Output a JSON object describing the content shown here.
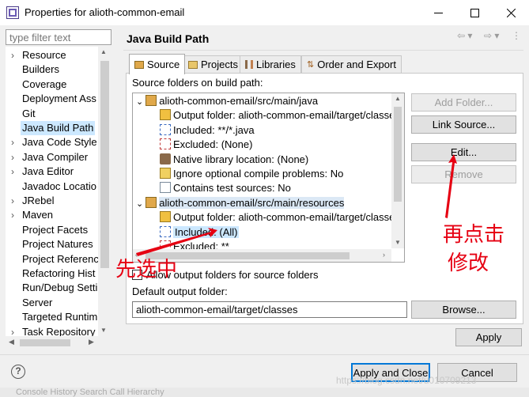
{
  "window": {
    "title": "Properties for alioth-common-email"
  },
  "filter": {
    "placeholder": "type filter text"
  },
  "nav": {
    "items": [
      {
        "label": "Resource",
        "expandable": true
      },
      {
        "label": "Builders",
        "expandable": false
      },
      {
        "label": "Coverage",
        "expandable": false
      },
      {
        "label": "Deployment Ass",
        "expandable": false
      },
      {
        "label": "Git",
        "expandable": false
      },
      {
        "label": "Java Build Path",
        "expandable": false,
        "selected": true
      },
      {
        "label": "Java Code Style",
        "expandable": true
      },
      {
        "label": "Java Compiler",
        "expandable": true
      },
      {
        "label": "Java Editor",
        "expandable": true
      },
      {
        "label": "Javadoc Locatio",
        "expandable": false
      },
      {
        "label": "JRebel",
        "expandable": true
      },
      {
        "label": "Maven",
        "expandable": true
      },
      {
        "label": "Project Facets",
        "expandable": false
      },
      {
        "label": "Project Natures",
        "expandable": false
      },
      {
        "label": "Project Referenc",
        "expandable": false
      },
      {
        "label": "Refactoring Hist",
        "expandable": false
      },
      {
        "label": "Run/Debug Setti",
        "expandable": false
      },
      {
        "label": "Server",
        "expandable": false
      },
      {
        "label": "Targeted Runtim",
        "expandable": false
      },
      {
        "label": "Task Repository",
        "expandable": true
      }
    ]
  },
  "page": {
    "title": "Java Build Path",
    "tabs": [
      {
        "label": "Source",
        "active": true
      },
      {
        "label": "Projects"
      },
      {
        "label": "Libraries"
      },
      {
        "label": "Order and Export"
      }
    ],
    "source_label": "Source folders on build path:",
    "source_tree": [
      {
        "text": "alioth-common-email/src/main/java",
        "icon": "source-folder-icon",
        "expanded": true
      },
      {
        "text": "Output folder: alioth-common-email/target/classes",
        "icon": "output-folder-icon"
      },
      {
        "text": "Included: **/*.java",
        "icon": "inclusion-filter-icon"
      },
      {
        "text": "Excluded: (None)",
        "icon": "exclusion-filter-icon"
      },
      {
        "text": "Native library location: (None)",
        "icon": "native-library-icon"
      },
      {
        "text": "Ignore optional compile problems: No",
        "icon": "ignore-problems-icon"
      },
      {
        "text": "Contains test sources: No",
        "icon": "test-sources-icon"
      },
      {
        "text": "alioth-common-email/src/main/resources",
        "icon": "source-folder-icon",
        "expanded": true,
        "highlight": true
      },
      {
        "text": "Output folder: alioth-common-email/target/classes",
        "icon": "output-folder-icon"
      },
      {
        "text": "Included: (All)",
        "icon": "inclusion-filter-icon",
        "selected": true
      },
      {
        "text": "Excluded: **",
        "icon": "exclusion-filter-icon"
      }
    ],
    "buttons": {
      "add_folder": "Add Folder...",
      "link_source": "Link Source...",
      "edit": "Edit...",
      "remove": "Remove"
    },
    "allow_output_label": "Allow output folders for source folders",
    "default_output_label": "Default output folder:",
    "default_output_value": "alioth-common-email/target/classes",
    "browse": "Browse...",
    "apply": "Apply"
  },
  "footer": {
    "apply_and_close": "Apply and Close",
    "cancel": "Cancel"
  },
  "annotations": {
    "first_select": "先选中",
    "then_click_1": "再点击",
    "then_click_2": "修改",
    "color": "#e60012"
  },
  "watermark": "https://blog.csdn.net/u010709213",
  "taskbar_text": "Console  History  Search  Call Hierarchy"
}
